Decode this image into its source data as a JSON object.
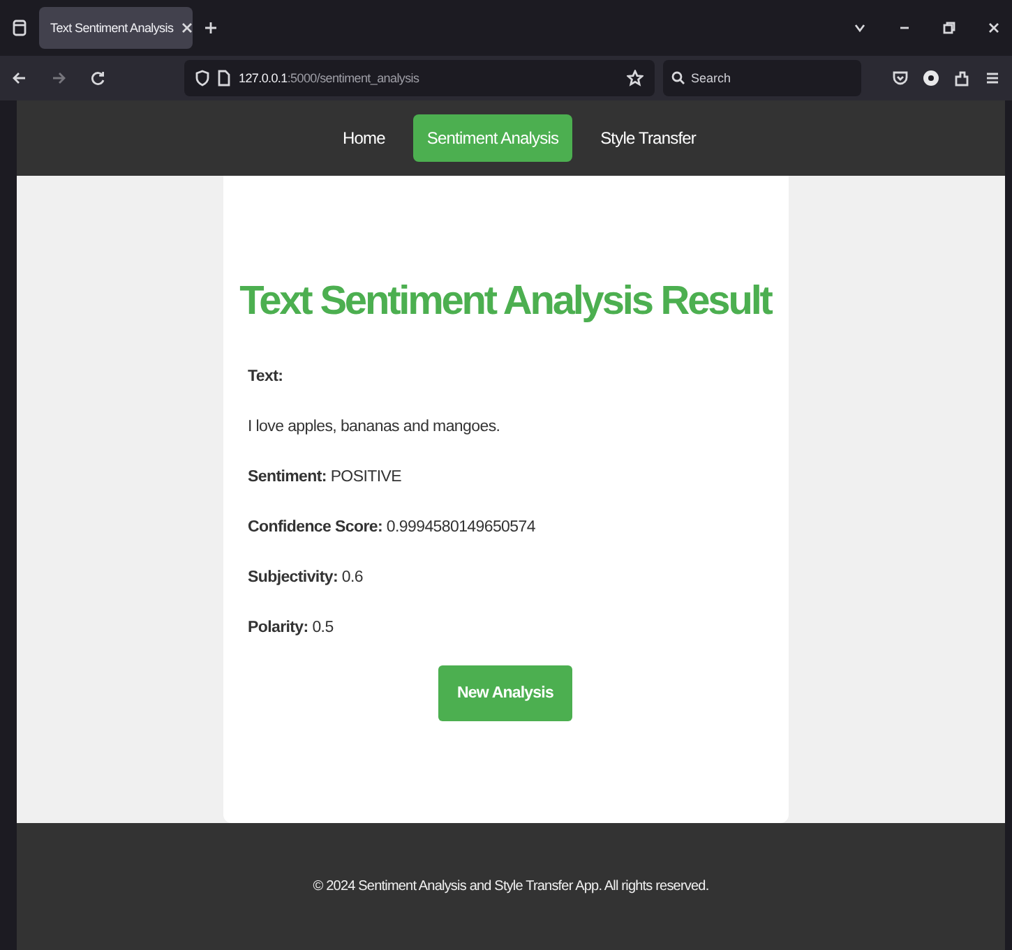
{
  "browser": {
    "tab_title": "Text Sentiment Analysis",
    "url_host": "127.0.0.1",
    "url_path": ":5000/sentiment_analysis",
    "search_placeholder": "Search"
  },
  "nav": [
    {
      "label": "Home",
      "selected": false
    },
    {
      "label": "Sentiment Analysis",
      "selected": true
    },
    {
      "label": "Style Transfer",
      "selected": false
    }
  ],
  "heading": "Text Sentiment Analysis Result",
  "results": [
    {
      "kind": "label",
      "text": "Text:"
    },
    {
      "kind": "paragraph",
      "text": "I love apples, bananas and mangoes."
    },
    {
      "kind": "field",
      "text": "**Sentiment:** POSITIVE"
    },
    {
      "kind": "field",
      "text": "**Confidence Score:** 0.9994580149650574"
    },
    {
      "kind": "field",
      "text": "**Subjectivity:** 0.6"
    },
    {
      "kind": "field",
      "text": "**Polarity:** 0.5"
    }
  ],
  "button": "New Analysis",
  "footer": "© 2024 Sentiment Analysis and Style Transfer App. All rights reserved."
}
